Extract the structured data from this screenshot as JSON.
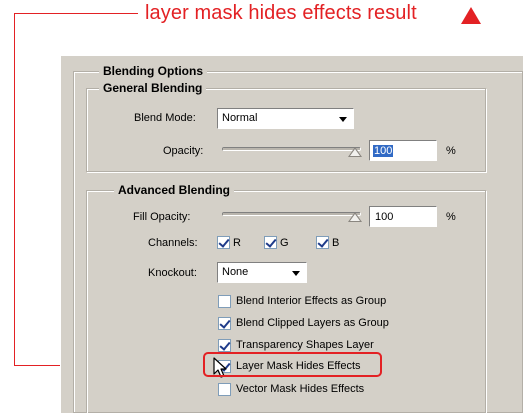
{
  "annotation": {
    "title": "layer mask hides effects result",
    "color": "#e32124",
    "marker_icon": "triangle-icon"
  },
  "dialog": {
    "blending_options_label": "Blending Options",
    "general_blending": {
      "heading": "General Blending",
      "blend_mode_label": "Blend Mode:",
      "blend_mode_value": "Normal",
      "opacity_label": "Opacity:",
      "opacity_value": "100",
      "opacity_unit": "%"
    },
    "advanced_blending": {
      "heading": "Advanced Blending",
      "fill_opacity_label": "Fill Opacity:",
      "fill_opacity_value": "100",
      "fill_opacity_unit": "%",
      "channels_label": "Channels:",
      "channels": [
        {
          "label": "R",
          "checked": true
        },
        {
          "label": "G",
          "checked": true
        },
        {
          "label": "B",
          "checked": true
        }
      ],
      "knockout_label": "Knockout:",
      "knockout_value": "None",
      "options": [
        {
          "label": "Blend Interior Effects as Group",
          "checked": false
        },
        {
          "label": "Blend Clipped Layers as Group",
          "checked": true
        },
        {
          "label": "Transparency Shapes Layer",
          "checked": true
        },
        {
          "label": "Layer Mask Hides Effects",
          "checked": true,
          "highlighted": true
        },
        {
          "label": "Vector Mask Hides Effects",
          "checked": false
        }
      ]
    }
  },
  "colors": {
    "panel": "#d4d0c8",
    "selection": "#316ac5"
  }
}
